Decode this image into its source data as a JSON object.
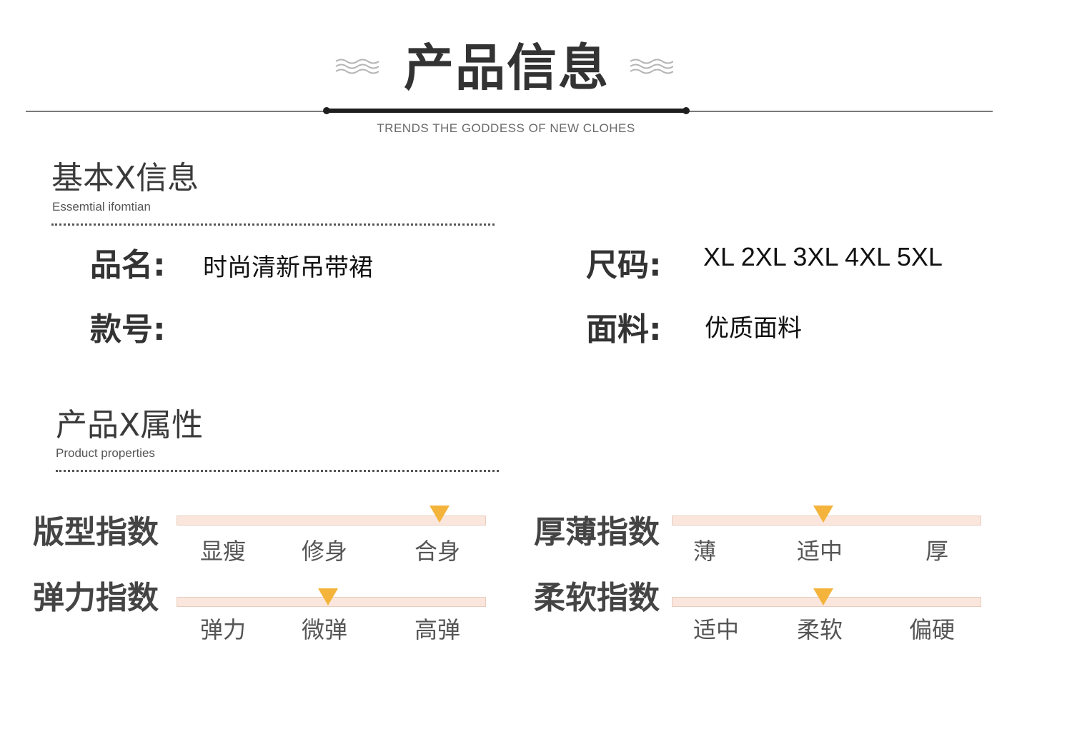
{
  "header": {
    "title": "产品信息",
    "subtitle": "TRENDS THE GODDESS OF NEW CLOHES"
  },
  "basic_info": {
    "title": "基本X信息",
    "subtitle": "Essemtial ifomtian",
    "rows": [
      {
        "key": "品名:",
        "value": "时尚清新吊带裙"
      },
      {
        "key": "尺码:",
        "value": "XL 2XL 3XL 4XL 5XL"
      },
      {
        "key": "款号:",
        "value": ""
      },
      {
        "key": "面料:",
        "value": "优质面料"
      }
    ]
  },
  "properties": {
    "title": "产品X属性",
    "subtitle": "Product properties",
    "marker_color": "#f4b43b",
    "bar_color": "#fae6dc",
    "indices": [
      {
        "label": "版型指数",
        "options": [
          "显瘦",
          "修身",
          "合身"
        ],
        "selected": "合身",
        "position": 0.85
      },
      {
        "label": "厚薄指数",
        "options": [
          "薄",
          "适中",
          "厚"
        ],
        "selected": "适中",
        "position": 0.49
      },
      {
        "label": "弹力指数",
        "options": [
          "弹力",
          "微弹",
          "高弹"
        ],
        "selected": "微弹",
        "position": 0.49
      },
      {
        "label": "柔软指数",
        "options": [
          "适中",
          "柔软",
          "偏硬"
        ],
        "selected": "柔软",
        "position": 0.49
      }
    ]
  }
}
